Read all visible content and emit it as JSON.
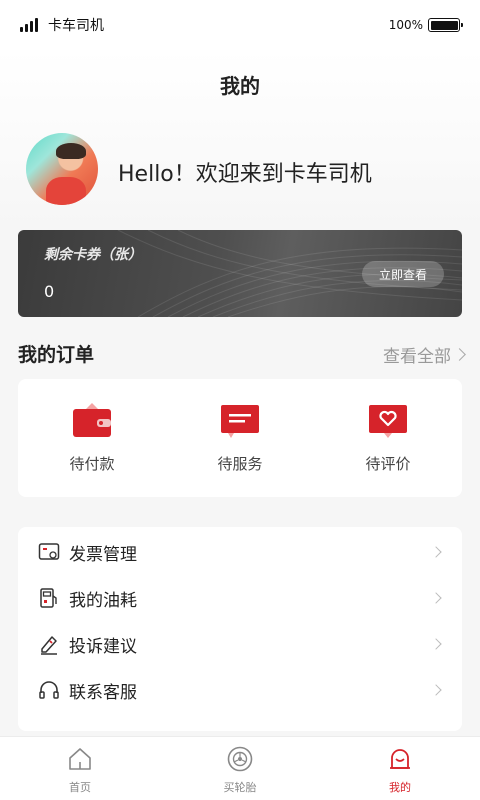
{
  "status_bar": {
    "carrier": "卡车司机",
    "battery": "100%"
  },
  "page": {
    "title": "我的"
  },
  "profile": {
    "greeting": "Hello！欢迎来到卡车司机"
  },
  "coupon": {
    "title": "剩余卡券（张）",
    "count": "0",
    "button": "立即查看"
  },
  "orders": {
    "title": "我的订单",
    "view_all": "查看全部",
    "items": [
      {
        "label": "待付款",
        "icon": "wallet-icon"
      },
      {
        "label": "待服务",
        "icon": "message-icon"
      },
      {
        "label": "待评价",
        "icon": "heart-review-icon"
      }
    ]
  },
  "menu": {
    "items": [
      {
        "label": "发票管理",
        "icon": "invoice-icon"
      },
      {
        "label": "我的油耗",
        "icon": "fuel-icon"
      },
      {
        "label": "投诉建议",
        "icon": "feedback-icon"
      },
      {
        "label": "联系客服",
        "icon": "headset-icon"
      }
    ]
  },
  "tabbar": {
    "items": [
      {
        "label": "首页",
        "icon": "home-icon",
        "active": false
      },
      {
        "label": "买轮胎",
        "icon": "tire-icon",
        "active": false
      },
      {
        "label": "我的",
        "icon": "profile-icon",
        "active": true
      }
    ]
  },
  "colors": {
    "accent": "#d6232a",
    "background": "#f6f6f6",
    "card": "#ffffff",
    "coupon_card": "#4a4a4a"
  }
}
